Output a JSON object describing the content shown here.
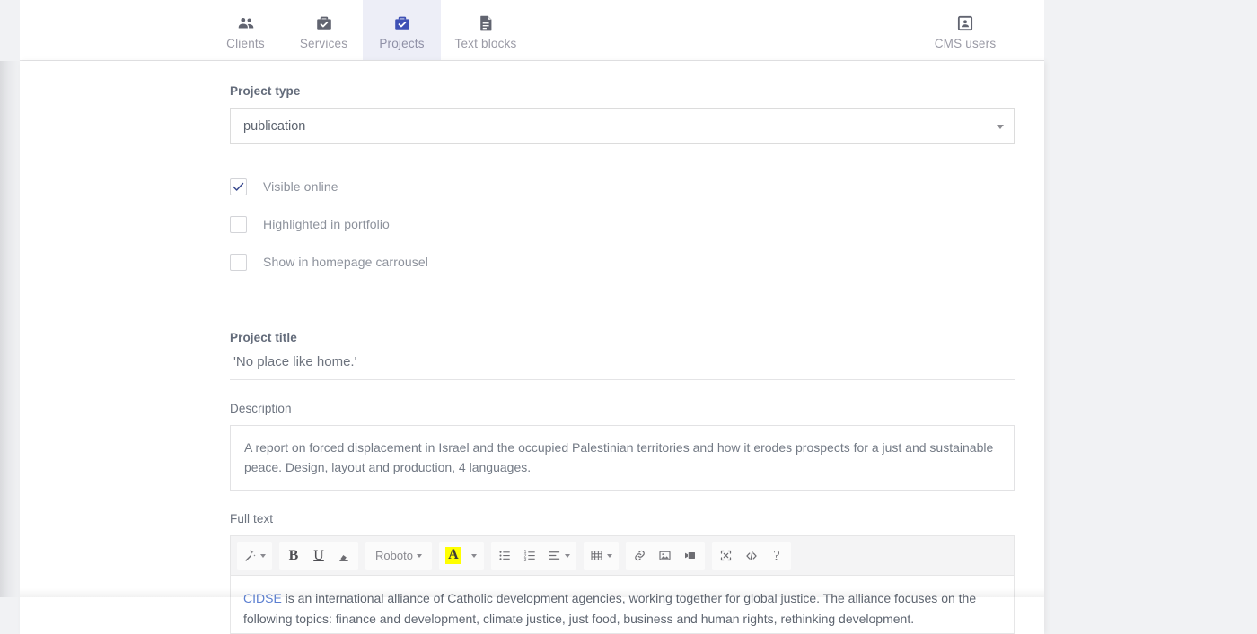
{
  "nav": {
    "items": [
      {
        "label": "Clients",
        "icon": "people-icon",
        "active": false
      },
      {
        "label": "Services",
        "icon": "briefcase-check-icon",
        "active": false
      },
      {
        "label": "Projects",
        "icon": "briefcase-check-icon",
        "active": true
      },
      {
        "label": "Text blocks",
        "icon": "document-icon",
        "active": false
      },
      {
        "label": "CMS users",
        "icon": "user-card-icon",
        "active": false
      }
    ],
    "active_color": "#3f51b5",
    "active_bg": "#edeef7"
  },
  "form": {
    "project_type": {
      "label": "Project type",
      "value": "publication",
      "options": [
        "publication"
      ]
    },
    "checkboxes": [
      {
        "label": "Visible online",
        "checked": true
      },
      {
        "label": "Highlighted in portfolio",
        "checked": false
      },
      {
        "label": "Show in homepage carrousel",
        "checked": false
      }
    ],
    "project_title": {
      "label": "Project title",
      "value": "'No place like home.'",
      "placeholder": "Project title"
    },
    "description": {
      "label": "Description",
      "value": "A report on forced displacement in Israel and the occupied Palestinian territories and how it erodes prospects for a just and sustainable peace. Design, layout and production, 4 languages."
    },
    "full_text": {
      "label": "Full text",
      "toolbar": {
        "groups": [
          {
            "buttons": [
              {
                "name": "magic-wand-icon",
                "label": "",
                "caret": true
              }
            ]
          },
          {
            "buttons": [
              {
                "name": "bold-button",
                "label": "B",
                "caret": false
              },
              {
                "name": "underline-button",
                "label": "U",
                "caret": false
              },
              {
                "name": "clear-format-icon",
                "label": "",
                "caret": false
              }
            ]
          },
          {
            "buttons": [
              {
                "name": "font-family-select",
                "label": "Roboto",
                "caret": true
              }
            ]
          },
          {
            "buttons": [
              {
                "name": "text-highlight-button",
                "label": "A",
                "caret": true
              }
            ]
          },
          {
            "buttons": [
              {
                "name": "bullet-list-icon",
                "label": "",
                "caret": false
              },
              {
                "name": "numbered-list-icon",
                "label": "",
                "caret": false
              },
              {
                "name": "align-icon",
                "label": "",
                "caret": true
              }
            ]
          },
          {
            "buttons": [
              {
                "name": "table-icon",
                "label": "",
                "caret": true
              }
            ]
          },
          {
            "buttons": [
              {
                "name": "link-icon",
                "label": "",
                "caret": false
              },
              {
                "name": "image-icon",
                "label": "",
                "caret": false
              },
              {
                "name": "video-icon",
                "label": "",
                "caret": false
              }
            ]
          },
          {
            "buttons": [
              {
                "name": "fullscreen-icon",
                "label": "",
                "caret": false
              },
              {
                "name": "code-view-icon",
                "label": "",
                "caret": false
              },
              {
                "name": "help-icon",
                "label": "?",
                "caret": false
              }
            ]
          }
        ],
        "font_family": "Roboto"
      },
      "content_link": "CIDSE",
      "content_rest": " is an international alliance of Catholic development agencies, working together for global justice. The alliance focuses on the following topics: finance and development, climate justice, just food, business and human rights, rethinking development."
    }
  }
}
